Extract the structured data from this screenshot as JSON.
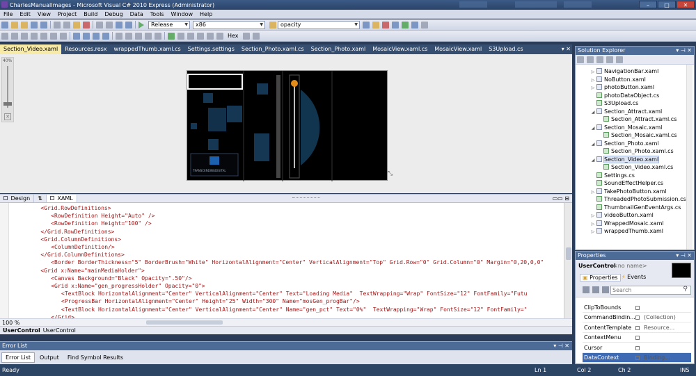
{
  "window": {
    "title": "CharlesManualImages - Microsoft Visual C# 2010 Express (Administrator)"
  },
  "menu": [
    "File",
    "Edit",
    "View",
    "Project",
    "Build",
    "Debug",
    "Data",
    "Tools",
    "Window",
    "Help"
  ],
  "toolbar": {
    "config": "Release",
    "platform": "x86",
    "find_text": "opacity",
    "hex_label": "Hex"
  },
  "doc_tabs": [
    "Section_Video.xaml",
    "Resources.resx",
    "wrappedThumb.xaml.cs",
    "Settings.settings",
    "Section_Photo.xaml.cs",
    "Section_Photo.xaml",
    "MosaicView.xaml.cs",
    "MosaicView.xaml",
    "S3Upload.cs"
  ],
  "designer": {
    "zoom_label": "40%",
    "logo_text": "TRANSCENDINGDIGITAL"
  },
  "split": {
    "design_tab": "Design",
    "swap_glyph": "⇅",
    "xaml_tab": "XAML"
  },
  "code_lines": [
    {
      "indent": 6,
      "text": "<Grid.RowDefinitions>"
    },
    {
      "indent": 8,
      "text": "<RowDefinition Height=\"Auto\" />"
    },
    {
      "indent": 8,
      "text": "<RowDefinition Height=\"100\" />"
    },
    {
      "indent": 6,
      "text": "</Grid.RowDefinitions>"
    },
    {
      "indent": 6,
      "text": "<Grid.ColumnDefinitions>"
    },
    {
      "indent": 8,
      "text": "<ColumnDefinition/>"
    },
    {
      "indent": 6,
      "text": "</Grid.ColumnDefinitions>"
    },
    {
      "indent": 8,
      "text": "<Border BorderThickness=\"5\" BorderBrush=\"White\" HorizontalAlignment=\"Center\" VerticalAlignment=\"Top\" Grid.Row=\"0\" Grid.Column=\"0\" Margin=\"0,20,0,0\""
    },
    {
      "indent": 6,
      "text": "<Grid x:Name=\"mainMediaHolder\">"
    },
    {
      "indent": 8,
      "text": "<Canvas Background=\"Black\" Opacity=\".50\"/>"
    },
    {
      "indent": 8,
      "text": "<Grid x:Name=\"gen_progressHolder\" Opacity=\"0\">"
    },
    {
      "indent": 10,
      "text": "<TextBlock HorizontalAlignment=\"Center\" VerticalAlignment=\"Center\" Text=\"Loading Media\"  TextWrapping=\"Wrap\" FontSize=\"12\" FontFamily=\"Futu"
    },
    {
      "indent": 10,
      "text": "<ProgressBar HorizontalAlignment=\"Center\" Height=\"25\" Width=\"300\" Name=\"mosGen_progBar\"/>"
    },
    {
      "indent": 10,
      "text": "<TextBlock HorizontalAlignment=\"Center\" VerticalAlignment=\"Center\" Name=\"gen_pct\" Text=\"0%\"  TextWrapping=\"Wrap\" FontSize=\"12\" FontFamily=\""
    },
    {
      "indent": 8,
      "text": "</Grid>"
    }
  ],
  "editor_zoom": "100 %",
  "breadcrumb": {
    "first": "UserControl",
    "second": "UserControl"
  },
  "solution_explorer": {
    "title": "Solution Explorer",
    "items": [
      {
        "label": "NavigationBar.xaml",
        "indent": 1,
        "arrow": "▷",
        "cs": false
      },
      {
        "label": "NoButton.xaml",
        "indent": 1,
        "arrow": "▷",
        "cs": false
      },
      {
        "label": "photoButton.xaml",
        "indent": 1,
        "arrow": "▷",
        "cs": false
      },
      {
        "label": "photoDataObject.cs",
        "indent": 1,
        "arrow": "",
        "cs": true
      },
      {
        "label": "S3Upload.cs",
        "indent": 1,
        "arrow": "",
        "cs": true
      },
      {
        "label": "Section_Attract.xaml",
        "indent": 1,
        "arrow": "◢",
        "cs": false
      },
      {
        "label": "Section_Attract.xaml.cs",
        "indent": 2,
        "arrow": "",
        "cs": true
      },
      {
        "label": "Section_Mosaic.xaml",
        "indent": 1,
        "arrow": "◢",
        "cs": false
      },
      {
        "label": "Section_Mosaic.xaml.cs",
        "indent": 2,
        "arrow": "",
        "cs": true
      },
      {
        "label": "Section_Photo.xaml",
        "indent": 1,
        "arrow": "◢",
        "cs": false
      },
      {
        "label": "Section_Photo.xaml.cs",
        "indent": 2,
        "arrow": "",
        "cs": true
      },
      {
        "label": "Section_Video.xaml",
        "indent": 1,
        "arrow": "◢",
        "cs": false,
        "selected": true
      },
      {
        "label": "Section_Video.xaml.cs",
        "indent": 2,
        "arrow": "",
        "cs": true
      },
      {
        "label": "Settings.cs",
        "indent": 1,
        "arrow": "",
        "cs": true
      },
      {
        "label": "SoundEffectHelper.cs",
        "indent": 1,
        "arrow": "",
        "cs": true
      },
      {
        "label": "TakePhotoButton.xaml",
        "indent": 1,
        "arrow": "▷",
        "cs": false
      },
      {
        "label": "ThreadedPhotoSubmission.cs",
        "indent": 1,
        "arrow": "",
        "cs": true
      },
      {
        "label": "ThumbnailGenEventArgs.cs",
        "indent": 1,
        "arrow": "",
        "cs": true
      },
      {
        "label": "videoButton.xaml",
        "indent": 1,
        "arrow": "▷",
        "cs": false
      },
      {
        "label": "WrappedMosaic.xaml",
        "indent": 1,
        "arrow": "▷",
        "cs": false
      },
      {
        "label": "wrappedThumb.xaml",
        "indent": 1,
        "arrow": "▷",
        "cs": false
      }
    ]
  },
  "properties": {
    "title": "Properties",
    "object_type": "UserControl",
    "object_name": "<no name>",
    "tab_properties": "Properties",
    "tab_events": "Events",
    "search_placeholder": "Search",
    "rows": [
      {
        "name": "ClipToBounds",
        "value": ""
      },
      {
        "name": "CommandBindin...",
        "value": "(Collection)"
      },
      {
        "name": "ContentTemplate",
        "value": "Resource..."
      },
      {
        "name": "ContextMenu",
        "value": ""
      },
      {
        "name": "Cursor",
        "value": ""
      },
      {
        "name": "DataContext",
        "value": "Binding..."
      }
    ]
  },
  "error_list": {
    "title": "Error List",
    "tabs": [
      "Error List",
      "Output",
      "Find Symbol Results"
    ]
  },
  "status": {
    "ready": "Ready",
    "ln": "Ln 1",
    "col": "Col 2",
    "ch": "Ch 2",
    "ins": "INS"
  }
}
